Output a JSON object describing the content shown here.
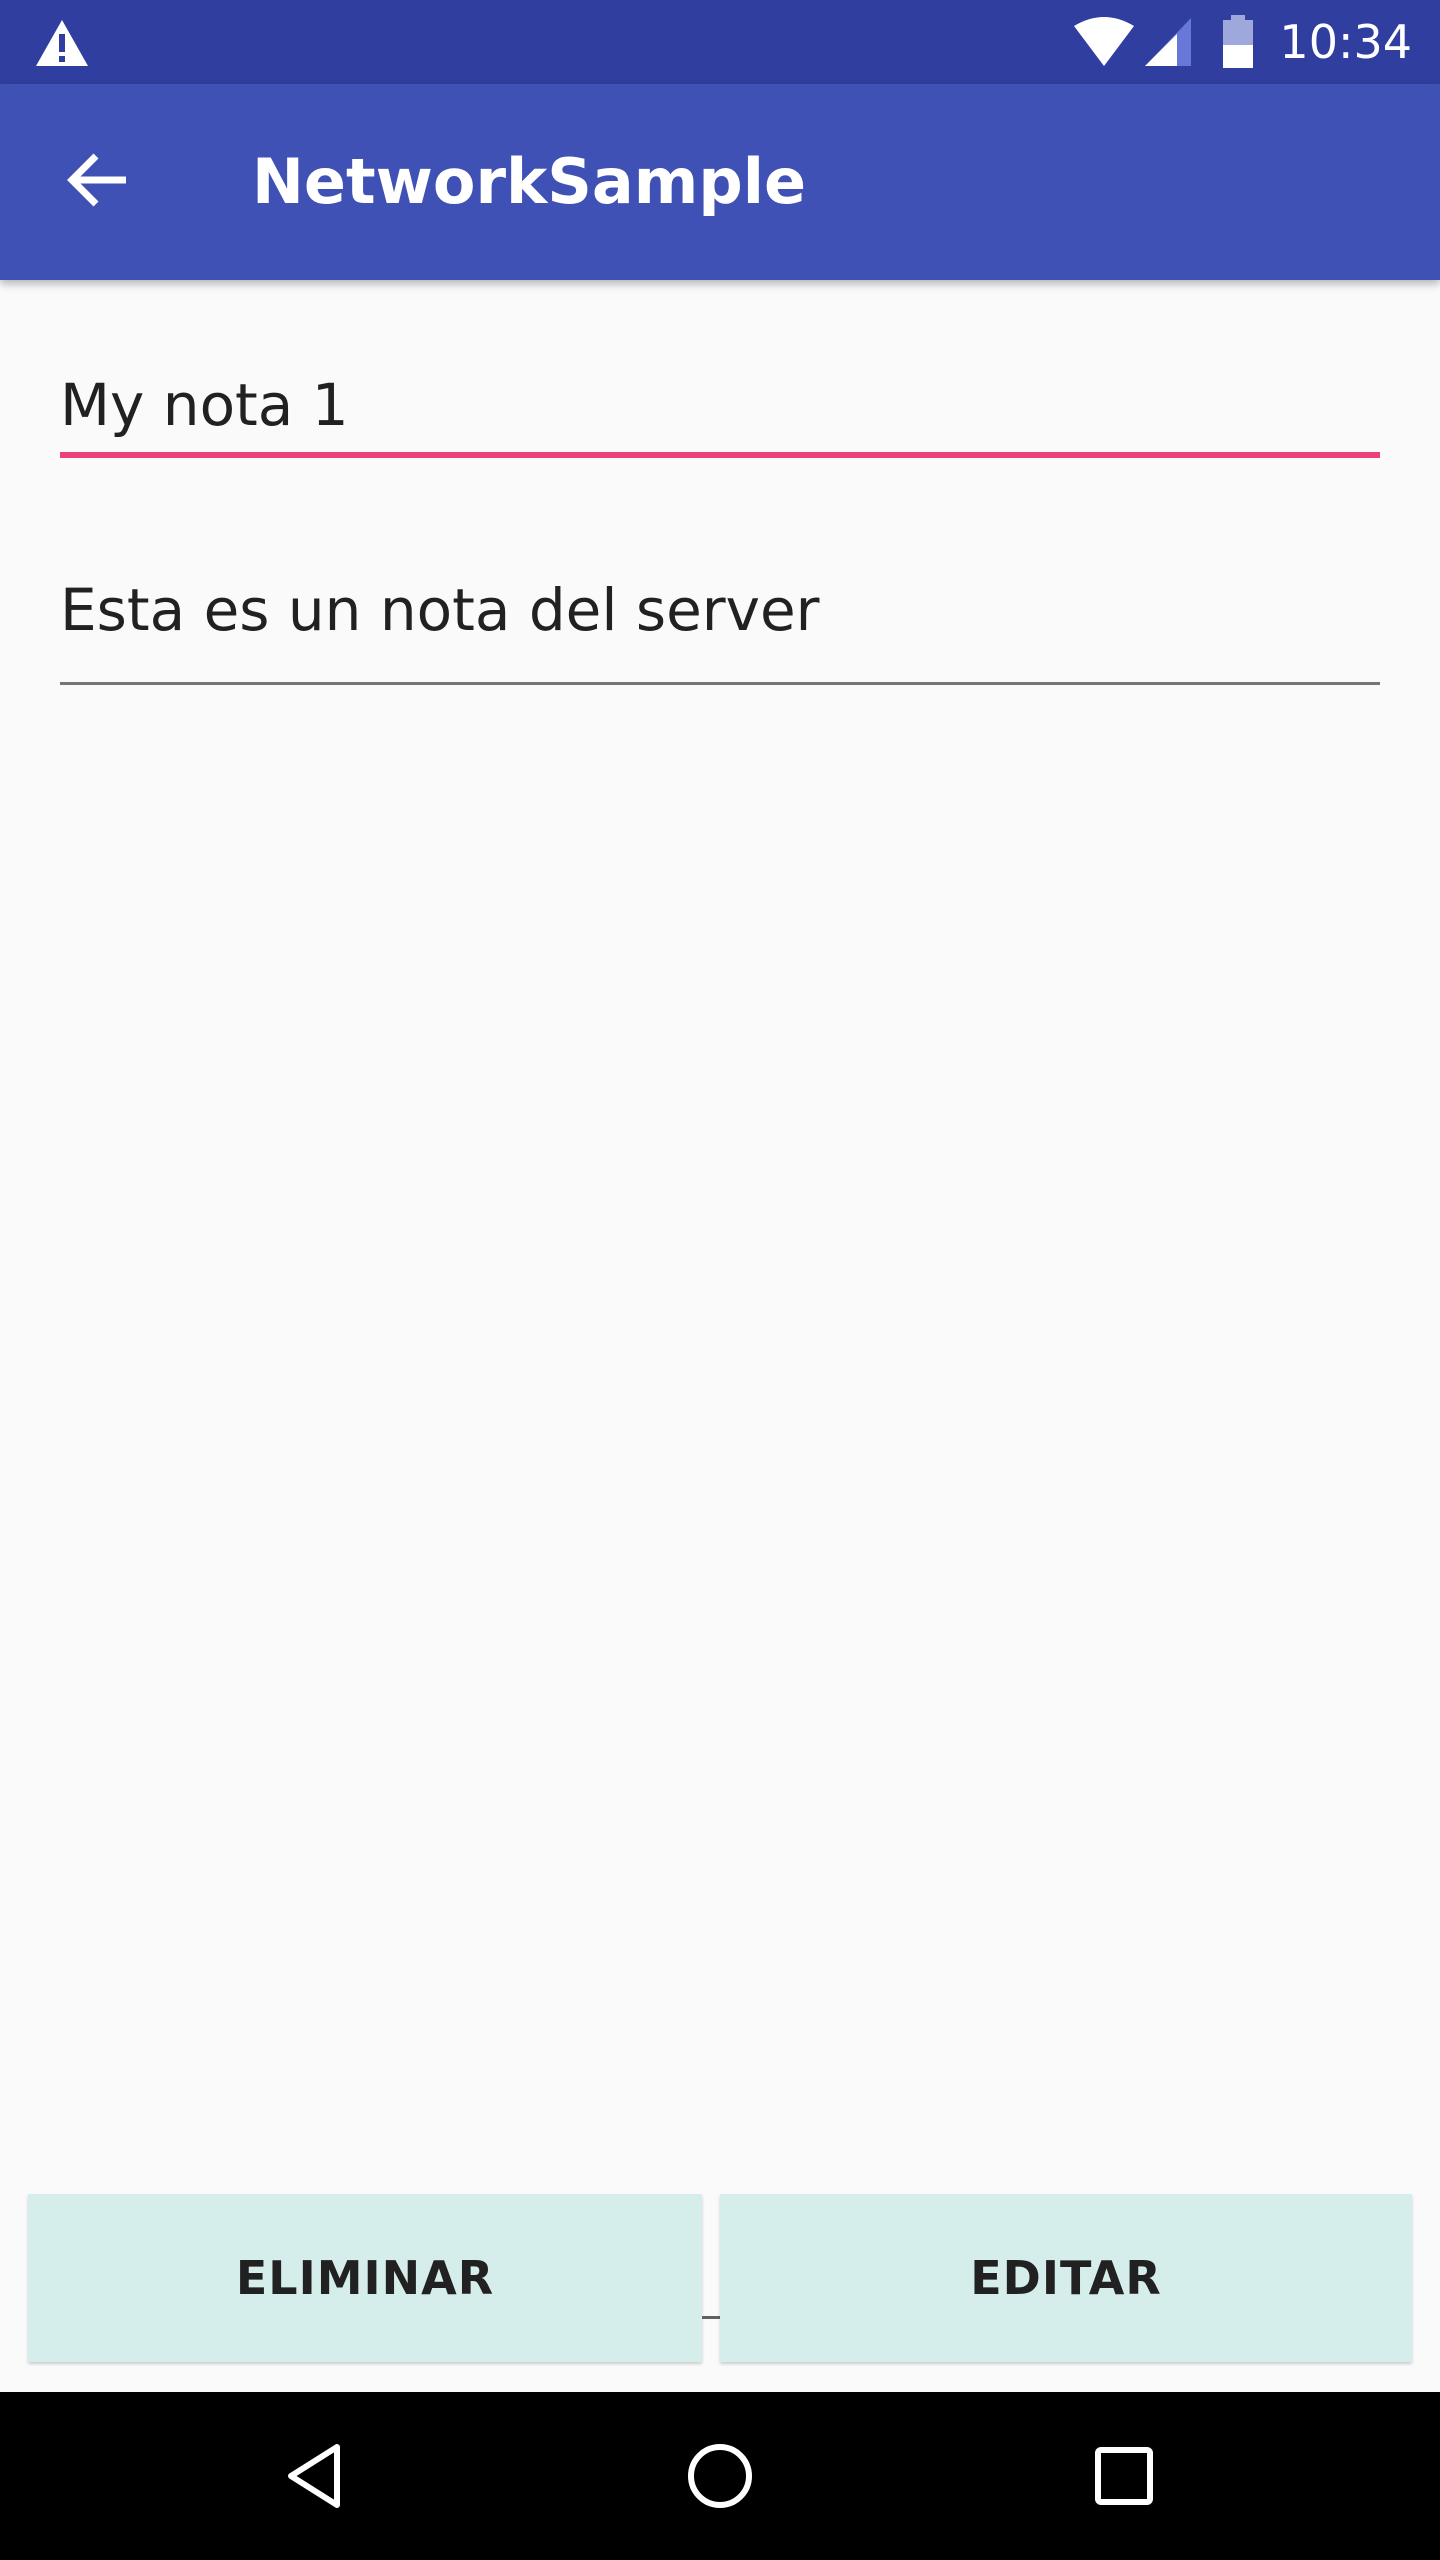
{
  "status_bar": {
    "time": "10:34",
    "icons": [
      "warning-icon",
      "wifi-icon",
      "signal-icon",
      "battery-icon"
    ]
  },
  "app_bar": {
    "title": "NetworkSample",
    "back_icon": "arrow-back-icon"
  },
  "form": {
    "title_value": "My nota 1",
    "body_value": "Esta es un nota del server"
  },
  "buttons": {
    "delete_label": "ELIMINAR",
    "edit_label": "EDITAR"
  },
  "nav_bar": {
    "icons": [
      "nav-back-icon",
      "nav-home-icon",
      "nav-recents-icon"
    ]
  },
  "colors": {
    "status_bar": "#303f9f",
    "app_bar": "#3f51b5",
    "accent": "#ec407a",
    "button_bg": "#d6eeeb",
    "background": "#fafafa"
  }
}
